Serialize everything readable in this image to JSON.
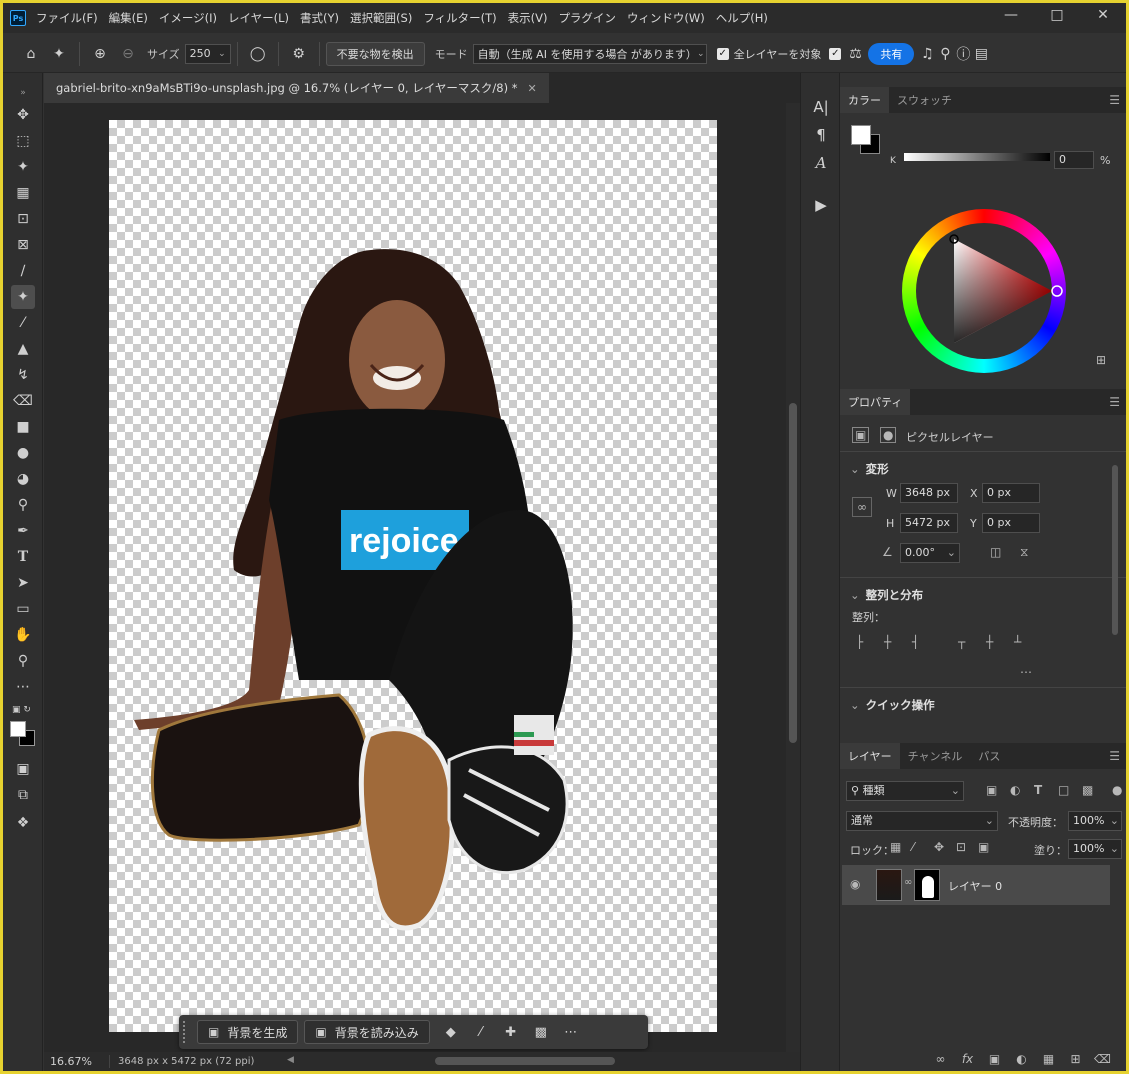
{
  "menu": {
    "items": [
      "ファイル(F)",
      "編集(E)",
      "イメージ(I)",
      "レイヤー(L)",
      "書式(Y)",
      "選択範囲(S)",
      "フィルター(T)",
      "表示(V)",
      "プラグイン",
      "ウィンドウ(W)",
      "ヘルプ(H)"
    ],
    "app_logo": "Ps"
  },
  "options": {
    "size_label": "サイズ",
    "size_value": "250",
    "detect_button": "不要な物を検出",
    "mode_label": "モード",
    "mode_value": "自動（生成 AI を使用する場合 があります）",
    "all_layers_label": "全レイヤーを対象",
    "share_button": "共有"
  },
  "document": {
    "tab_title": "gabriel-brito-xn9aMsBTi9o-unsplash.jpg @ 16.7% (レイヤー 0, レイヤーマスク/8) *",
    "shirt_text": "rejoice"
  },
  "taskbar": {
    "generate_bg": "背景を生成",
    "import_bg": "背景を読み込み"
  },
  "status": {
    "zoom": "16.67%",
    "dimensions": "3648 px x 5472 px (72 ppi)"
  },
  "color_panel": {
    "tabs": [
      "カラー",
      "スウォッチ"
    ],
    "k_label": "K",
    "k_value": "0",
    "pct": "%"
  },
  "properties": {
    "tab": "プロパティ",
    "layer_type": "ピクセルレイヤー",
    "transform_title": "変形",
    "w_label": "W",
    "w_value": "3648 px",
    "h_label": "H",
    "h_value": "5472 px",
    "x_label": "X",
    "x_value": "0 px",
    "y_label": "Y",
    "y_value": "0 px",
    "angle_value": "0.00°",
    "align_title": "整列と分布",
    "align_label": "整列：",
    "quick_title": "クイック操作"
  },
  "layers": {
    "tabs": [
      "レイヤー",
      "チャンネル",
      "パス"
    ],
    "filter_kind": "種類",
    "blend_mode": "通常",
    "opacity_label": "不透明度：",
    "opacity_value": "100%",
    "lock_label": "ロック：",
    "fill_label": "塗り：",
    "fill_value": "100%",
    "layer_name": "レイヤー 0"
  },
  "colors": {
    "accent": "#1473e6",
    "frame": "#e6d230",
    "shirt_blue": "#1ea0dc"
  }
}
